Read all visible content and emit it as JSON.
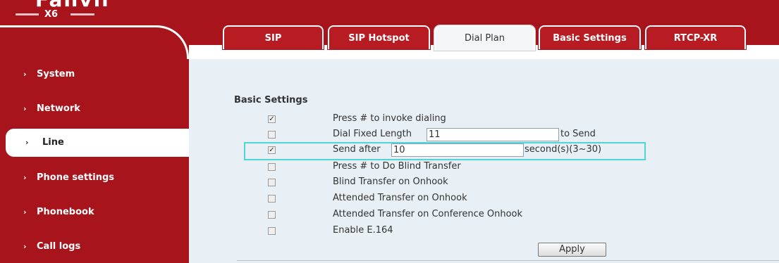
{
  "header": {
    "logo_text": "Fanvil",
    "model": "X6"
  },
  "sidebar": {
    "items": [
      {
        "label": "System"
      },
      {
        "label": "Network"
      },
      {
        "label": "Line"
      },
      {
        "label": "Phone settings"
      },
      {
        "label": "Phonebook"
      },
      {
        "label": "Call logs"
      }
    ],
    "active": "Line"
  },
  "tabs": [
    {
      "label": "SIP"
    },
    {
      "label": "SIP Hotspot"
    },
    {
      "label": "Dial Plan"
    },
    {
      "label": "Basic Settings"
    },
    {
      "label": "RTCP-XR"
    }
  ],
  "active_tab": "Dial Plan",
  "basic_settings": {
    "title": "Basic Settings",
    "options": [
      {
        "label": "Press # to invoke dialing",
        "checked": true
      },
      {
        "label": "Dial Fixed Length",
        "checked": false,
        "value": "11",
        "suffix": "to Send"
      },
      {
        "label": "Send after",
        "checked": true,
        "value": "10",
        "suffix": "second(s)(3~30)"
      },
      {
        "label": "Press # to Do Blind Transfer",
        "checked": false
      },
      {
        "label": "Blind Transfer on Onhook",
        "checked": false
      },
      {
        "label": "Attended Transfer on Onhook",
        "checked": false
      },
      {
        "label": "Attended Transfer on Conference Onhook",
        "checked": false
      },
      {
        "label": "Enable E.164",
        "checked": false
      }
    ],
    "apply_label": "Apply"
  },
  "colors": {
    "brand_red": "#a8141c",
    "highlight": "#4fd6d6",
    "content_bg": "#e8f0f5"
  },
  "check_glyph": "✓"
}
